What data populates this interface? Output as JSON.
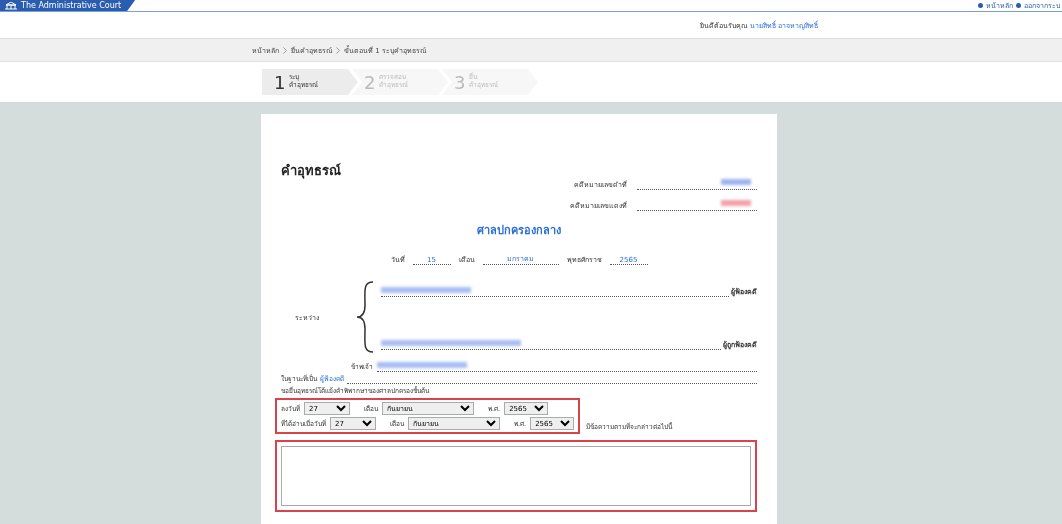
{
  "header": {
    "brand": "The Administrative Court",
    "links": [
      {
        "label": "หน้าหลัก"
      },
      {
        "label": "ออกจากระบ"
      }
    ]
  },
  "welcome": {
    "label": "ยินดีต้อนรับคุณ",
    "user": "นายสิทธิ์ อาจหาญสิทธิ์"
  },
  "breadcrumb": [
    "หน้าหลัก",
    "ยื่นคำอุทธรณ์",
    "ขั้นตอนที่ 1 ระบุคำอุทธรณ์"
  ],
  "steps": [
    {
      "number": "1",
      "line1": "ระบุ",
      "line2": "คำอุทธรณ์",
      "selected": true
    },
    {
      "number": "2",
      "line1": "ตรวจสอบ",
      "line2": "คำอุทธรณ์",
      "selected": false
    },
    {
      "number": "3",
      "line1": "ยื่น",
      "line2": "คำอุทธรณ์",
      "selected": false
    }
  ],
  "form": {
    "title": "คำอุทธรณ์",
    "case_numbers": [
      {
        "label": "คดีหมายเลขดำที่",
        "color": "#9db4f0"
      },
      {
        "label": "คดีหมายเลขแดงที่",
        "color": "#f2a0a8"
      }
    ],
    "court": "ศาลปกครองกลาง",
    "date": {
      "day_label": "วันที่",
      "day": "15",
      "month_label": "เดือน",
      "month": "มกราคม",
      "year_label": "พุทธศักราช",
      "year": "2565"
    },
    "between": "ระหว่าง",
    "plaintiff_label": "ผู้ฟ้องคดี",
    "defendant_label": "ผู้ถูกฟ้องคดี",
    "i_label": "ข้าพเจ้า",
    "capacity_label": "ในฐานะที่เป็น",
    "capacity": "ผู้ฟ้องคดี",
    "appeal_text": "ขอยื่นอุทธรณ์โต้แย้งคำพิพากษาของศาลปกครองชั้นต้น",
    "date_rows": [
      {
        "label": "ลงวันที่",
        "day": "27",
        "month_label": "เดือน",
        "month": "กันยายน",
        "year_label": "พ.ศ.",
        "year": "2565"
      },
      {
        "label": "ที่ได้อ่านเมื่อวันที่",
        "day": "27",
        "month_label": "เดือน",
        "month": "กันยายน",
        "year_label": "พ.ศ.",
        "year": "2565"
      }
    ],
    "following": "มีข้อความตามที่จะกล่าวต่อไปนี้"
  }
}
